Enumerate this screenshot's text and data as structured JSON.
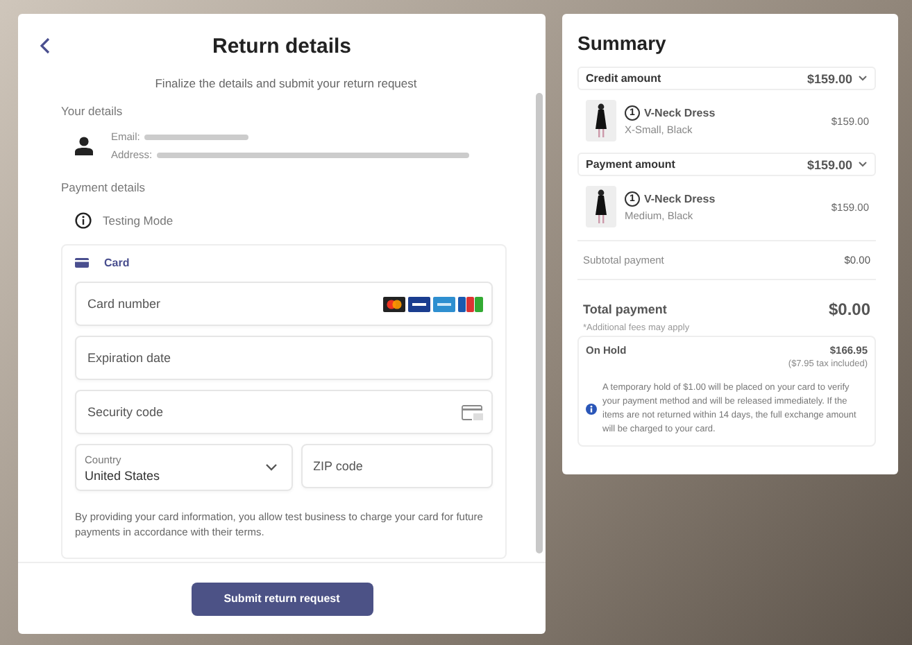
{
  "details": {
    "title": "Return details",
    "subtitle": "Finalize the details and submit your return request",
    "your_details_label": "Your details",
    "email_label": "Email:",
    "address_label": "Address:",
    "payment_details_label": "Payment details",
    "testing_mode": "Testing Mode"
  },
  "card_form": {
    "tab_label": "Card",
    "card_number": {
      "placeholder": "Card number"
    },
    "expiration": {
      "placeholder": "Expiration date"
    },
    "security": {
      "placeholder": "Security code"
    },
    "country": {
      "label": "Country",
      "value": "United States"
    },
    "zip": {
      "placeholder": "ZIP code"
    },
    "consent": "By providing your card information, you allow test business to charge your card for future payments in accordance with their terms."
  },
  "submit_button": "Submit return request",
  "summary": {
    "title": "Summary",
    "sections": [
      {
        "label": "Credit amount",
        "amount": "$159.00",
        "items": [
          {
            "quantity": "1",
            "name": "V-Neck Dress",
            "variant": "X-Small, Black",
            "price": "$159.00"
          }
        ]
      },
      {
        "label": "Payment amount",
        "amount": "$159.00",
        "items": [
          {
            "quantity": "1",
            "name": "V-Neck Dress",
            "variant": "Medium, Black",
            "price": "$159.00"
          }
        ]
      }
    ],
    "subtotal_label": "Subtotal payment",
    "subtotal": "$0.00",
    "total_label": "Total payment",
    "total": "$0.00",
    "fees_note": "*Additional fees may apply",
    "on_hold": {
      "label": "On Hold",
      "amount": "$166.95",
      "tax": "($7.95 tax included)",
      "notice": "A temporary hold of $1.00 will be placed on your card to verify your payment method and will be released immediately. If the items are not returned within 14 days, the full exchange amount will be charged to your card."
    }
  }
}
